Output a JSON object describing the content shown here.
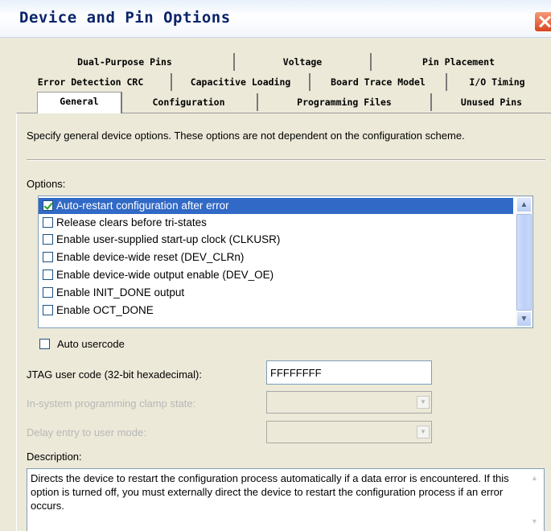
{
  "window": {
    "title": "Device and Pin Options"
  },
  "tabs": {
    "row1": [
      "Dual-Purpose Pins",
      "Voltage",
      "Pin Placement"
    ],
    "row2": [
      "Error Detection CRC",
      "Capacitive Loading",
      "Board Trace Model",
      "I/O Timing"
    ],
    "row3": [
      "General",
      "Configuration",
      "Programming Files",
      "Unused Pins"
    ],
    "active": "General"
  },
  "general": {
    "intro": "Specify general device options. These options are not dependent on the configuration scheme.",
    "options_label": "Options:",
    "options": [
      {
        "label": "Auto-restart configuration after error",
        "checked": true,
        "selected": true
      },
      {
        "label": "Release clears before tri-states",
        "checked": false,
        "selected": false
      },
      {
        "label": "Enable user-supplied start-up clock (CLKUSR)",
        "checked": false,
        "selected": false
      },
      {
        "label": "Enable device-wide reset (DEV_CLRn)",
        "checked": false,
        "selected": false
      },
      {
        "label": "Enable device-wide output enable (DEV_OE)",
        "checked": false,
        "selected": false
      },
      {
        "label": "Enable INIT_DONE output",
        "checked": false,
        "selected": false
      },
      {
        "label": "Enable OCT_DONE",
        "checked": false,
        "selected": false
      }
    ],
    "auto_usercode_label": "Auto usercode",
    "auto_usercode_checked": false,
    "jtag_label": "JTAG user code (32-bit hexadecimal):",
    "jtag_value": "FFFFFFFF",
    "clamp_label": "In-system programming clamp state:",
    "clamp_value": "",
    "delay_label": "Delay entry to user mode:",
    "delay_value": "",
    "description_label": "Description:",
    "description": "Directs the device to restart the configuration process automatically if a data error is encountered. If this option is turned off, you must externally direct the device to restart the configuration process if an error occurs."
  },
  "colors": {
    "selection": "#3169c6",
    "title_text": "#0a246a",
    "close_button": "#d8461f",
    "dialog_bg": "#ece9d8"
  },
  "icons": {
    "close": "close-icon",
    "scroll_up": "chevron-up-icon",
    "scroll_down": "chevron-down-icon",
    "combo_arrow": "chevron-down-icon",
    "checkbox": "checkmark-icon"
  }
}
